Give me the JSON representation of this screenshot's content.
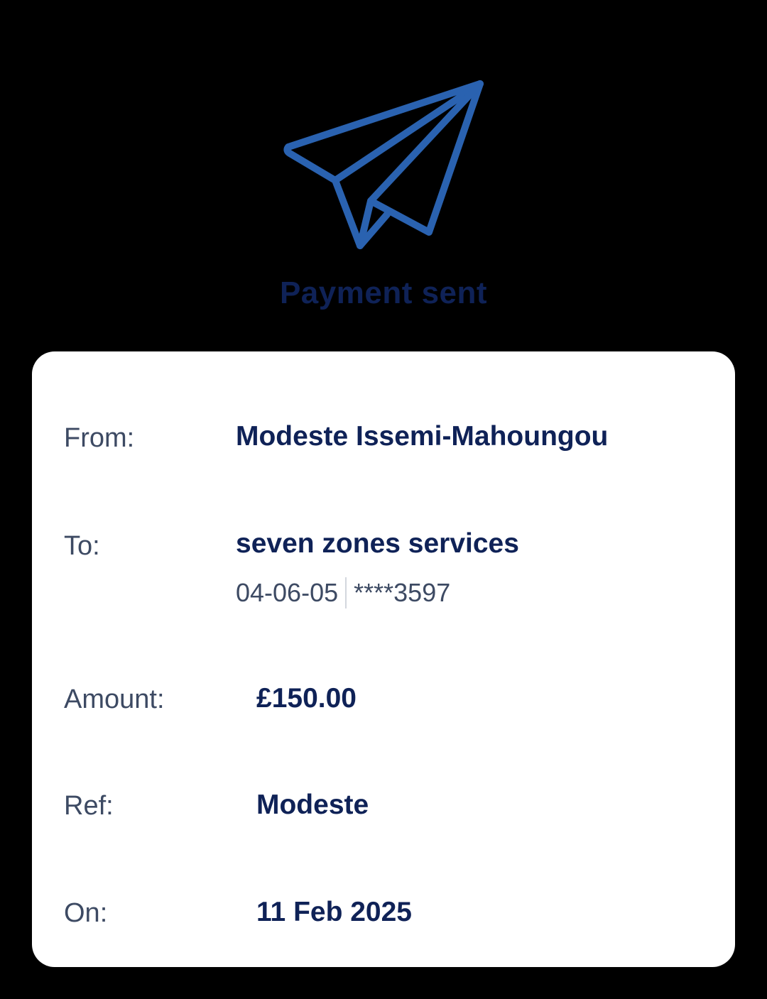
{
  "header": {
    "icon": "paper-plane-icon",
    "title": "Payment sent",
    "accent_color": "#2a62b0"
  },
  "details": {
    "from_label": "From:",
    "from_value": "Modeste Issemi-Mahoungou",
    "to_label": "To:",
    "to_value": "seven zones services",
    "sort_code": "04-06-05",
    "account_number": "****3597",
    "amount_label": "Amount:",
    "amount_value": "£150.00",
    "ref_label": "Ref:",
    "ref_value": "Modeste",
    "on_label": "On:",
    "on_value": "11 Feb 2025"
  }
}
